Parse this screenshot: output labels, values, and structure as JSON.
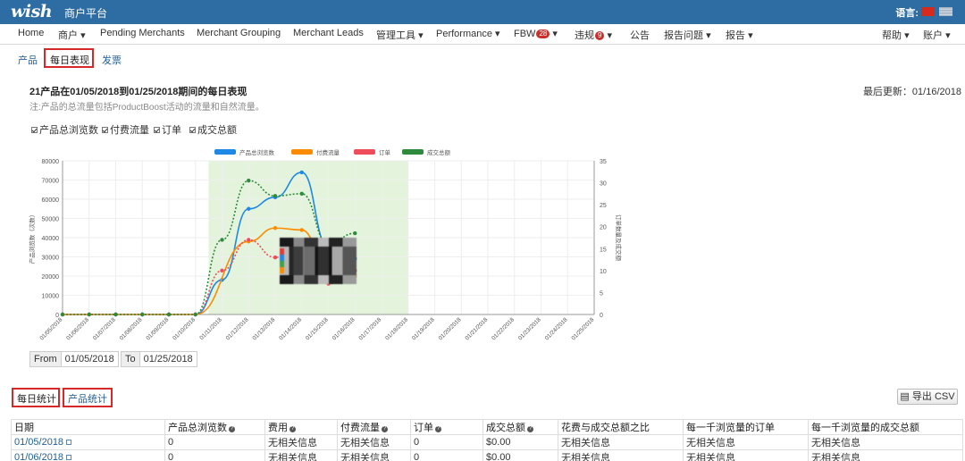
{
  "header": {
    "logo": "wish",
    "subtitle": "商户平台",
    "language_label": "语言:"
  },
  "nav": {
    "items": [
      "Home",
      "商户",
      "Pending Merchants",
      "Merchant Grouping",
      "Merchant Leads",
      "管理工具",
      "Performance",
      "FBW",
      "违规",
      "公告",
      "报告问题",
      "报告",
      "帮助",
      "账户"
    ],
    "fbw_badge": "28",
    "violation_badge": "9"
  },
  "subtabs": [
    "产品",
    "每日表现",
    "发票"
  ],
  "report": {
    "title": "21产品在01/05/2018到01/25/2018期间的每日表现",
    "note": "注:产品的总流量包括ProductBoost活动的流量和自然流量。",
    "last_updated": "最后更新：01/16/2018"
  },
  "checkboxes": [
    "产品总浏览数",
    "付费流量",
    "订单",
    "成交总额"
  ],
  "chart_data": {
    "type": "line",
    "x": [
      "01/05/2018",
      "01/06/2018",
      "01/07/2018",
      "01/08/2018",
      "01/09/2018",
      "01/10/2018",
      "01/11/2018",
      "01/12/2018",
      "01/13/2018",
      "01/14/2018",
      "01/15/2018",
      "01/16/2018",
      "01/17/2018",
      "01/18/2018",
      "01/19/2018",
      "01/20/2018",
      "01/21/2018",
      "01/22/2018",
      "01/23/2018",
      "01/24/2018",
      "01/25/2018"
    ],
    "series": [
      {
        "name": "产品总浏览数",
        "axis": "left",
        "color": "#1e88e5",
        "style": "solid",
        "values": [
          0,
          0,
          0,
          0,
          0,
          0,
          18000,
          55000,
          61000,
          74000,
          35000,
          29000
        ]
      },
      {
        "name": "付费流量",
        "axis": "left",
        "color": "#fb8c00",
        "style": "solid",
        "values": [
          0,
          0,
          0,
          0,
          0,
          0,
          null,
          38000,
          45000,
          44000,
          22000,
          20000
        ]
      },
      {
        "name": "订单",
        "axis": "right",
        "color": "#ef4d5c",
        "style": "dashed",
        "values": [
          0,
          0,
          0,
          0,
          0,
          0,
          10,
          17,
          13,
          16,
          7,
          10
        ]
      },
      {
        "name": "成交总额",
        "axis": "right",
        "color": "#2e8b3e",
        "style": "dashed",
        "values": [
          0,
          0,
          0,
          0,
          0,
          0,
          17,
          30.5,
          27,
          27.5,
          16,
          18.5
        ]
      }
    ],
    "ylim_left": [
      0,
      80000
    ],
    "yticks_left": [
      "0",
      "10000",
      "20000",
      "30000",
      "40000",
      "50000",
      "60000",
      "70000",
      "80000"
    ],
    "ylim_right": [
      0,
      35
    ],
    "yticks_right": [
      "0",
      "5",
      "10",
      "15",
      "20",
      "25",
      "30",
      "35"
    ],
    "ylabel_left": "产品浏览数（次数）",
    "ylabel_right": "订单数量及成交额",
    "highlight_range": [
      "01/11/2018",
      "01/18/2018"
    ],
    "legend_position": "top",
    "grid": true
  },
  "date_range": {
    "from_label": "From",
    "from_value": "01/05/2018",
    "to_label": "To",
    "to_value": "01/25/2018"
  },
  "stats_tabs": [
    "每日统计",
    "产品统计"
  ],
  "export_label": "导出 CSV",
  "table": {
    "headers": [
      "日期",
      "产品总浏览数",
      "费用",
      "付费流量",
      "订单",
      "成交总额",
      "花费与成交总额之比",
      "每一千浏览量的订单",
      "每一千浏览量的成交总额"
    ],
    "rows": [
      [
        "01/05/2018",
        "0",
        "无相关信息",
        "无相关信息",
        "0",
        "$0.00",
        "无相关信息",
        "无相关信息",
        "无相关信息"
      ],
      [
        "01/06/2018",
        "0",
        "无相关信息",
        "无相关信息",
        "0",
        "$0.00",
        "无相关信息",
        "无相关信息",
        "无相关信息"
      ]
    ]
  },
  "colors": {
    "header_bg": "#2e6da4",
    "link": "#1f5e99",
    "highlight": "#d62828",
    "chart_band": "#e4f4dc"
  }
}
